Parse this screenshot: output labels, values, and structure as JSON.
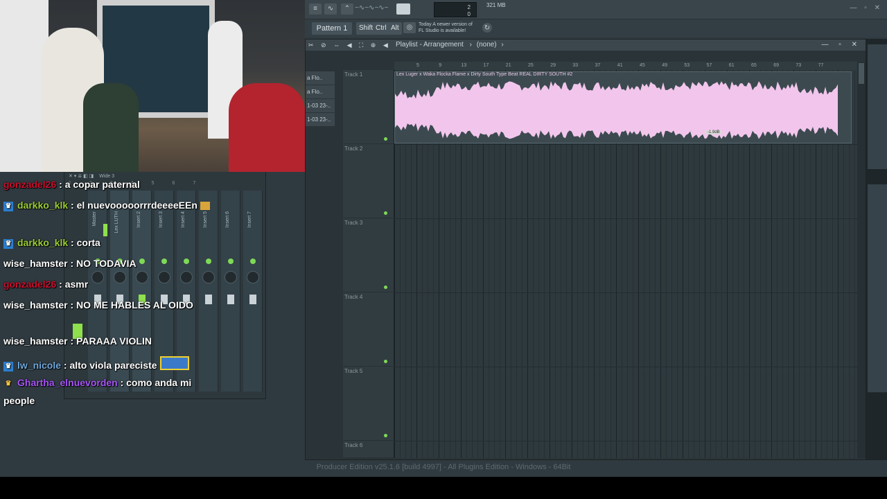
{
  "toolbar": {
    "cpu": "2",
    "cpu_sub": "0",
    "memory": "321 MB",
    "pattern_label": "Pattern 1",
    "keys": [
      "Shift",
      "Ctrl",
      "Alt"
    ],
    "news_line1": "Today  A newer version of",
    "news_line2": "FL Studio is available!"
  },
  "playlist": {
    "title": "Playlist - Arrangement",
    "pattern": "(none)",
    "browser_items": [
      "a Flo..",
      "a Flo..",
      "1-03 23-..",
      "1-03 23-.."
    ],
    "ruler_ticks": [
      "5",
      "9",
      "13",
      "17",
      "21",
      "25",
      "29",
      "33",
      "37",
      "41",
      "45",
      "49",
      "53",
      "57",
      "61",
      "65",
      "69",
      "73",
      "77"
    ],
    "tracks": [
      "Track 1",
      "Track 2",
      "Track 3",
      "Track 4",
      "Track 5",
      "Track 6"
    ],
    "clip_title": "Lex Luger x Waka Flocka Flame x Dirty South Type Beat REAL DIRTY SOUTH #2",
    "gain_label": "-1.9dB"
  },
  "mixer": {
    "strips": [
      "Master",
      "Lex LUTH",
      "Insert 2",
      "Insert 3",
      "Insert 4",
      "Insert 5",
      "Insert 6",
      "Insert 7"
    ],
    "header": "Wide 3"
  },
  "status": {
    "text": "Producer Edition v25.1.6 [build 4997] - All Plugins Edition - Windows - 64Bit"
  },
  "chat": {
    "messages": [
      {
        "user": "gonzadel26",
        "color": "#c8102e",
        "text": ": a copar paternal",
        "badge": ""
      },
      {
        "user": "darkko_klk",
        "color": "#9acd32",
        "text": ": el nuevooooorrrdeeeeEEn",
        "badge": "prime"
      },
      {
        "user": "darkko_klk",
        "color": "#9acd32",
        "text": ": corta",
        "badge": "prime"
      },
      {
        "user": "wise_hamster",
        "color": "#ffffff",
        "text": ": NO TODAVIA",
        "badge": ""
      },
      {
        "user": "gonzadel26",
        "color": "#c8102e",
        "text": ": asmr",
        "badge": ""
      },
      {
        "user": "wise_hamster",
        "color": "#ffffff",
        "text": ": NO ME HABLES AL OIDO",
        "badge": ""
      },
      {
        "user": "wise_hamster",
        "color": "#ffffff",
        "text": ": PARAAA VIOLIN",
        "badge": ""
      },
      {
        "user": "lw_nicole",
        "color": "#6fa8dc",
        "text": ": alto viola pareciste",
        "badge": "prime"
      },
      {
        "user": "Ghartha_elnuevorden",
        "color": "#a855f7",
        "text": ": como anda mi",
        "badge": "crown"
      },
      {
        "user": "",
        "color": "#ffffff",
        "text": "people",
        "badge": ""
      }
    ]
  },
  "colors": {
    "accent_green": "#7ed957",
    "clip_pink": "#f2c6ec",
    "bg_panel": "#2f3a40"
  }
}
